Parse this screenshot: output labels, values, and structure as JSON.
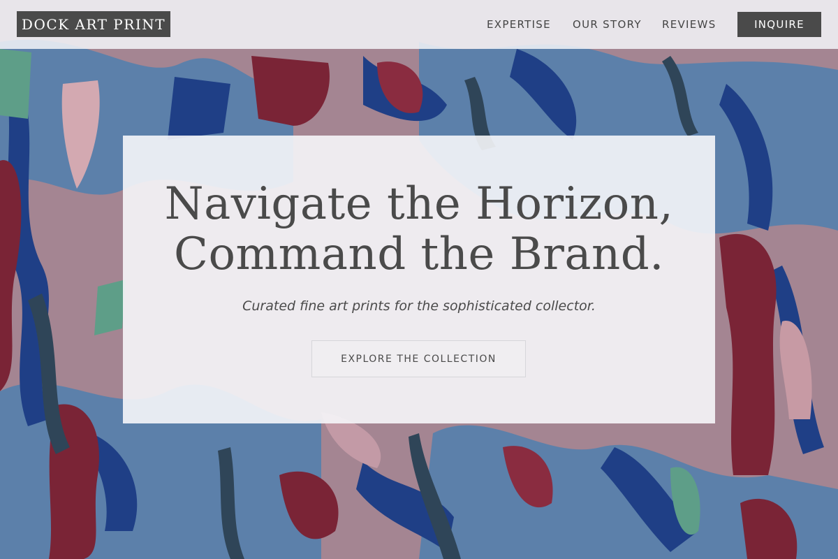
{
  "brand": {
    "logo_text": "DOCK ART PRINT"
  },
  "nav": {
    "items": [
      {
        "label": "EXPERTISE"
      },
      {
        "label": "OUR STORY"
      },
      {
        "label": "REVIEWS"
      }
    ],
    "cta_label": "INQUIRE"
  },
  "hero": {
    "headline_line1": "Navigate the Horizon,",
    "headline_line2": "Command the Brand.",
    "tagline": "Curated fine art prints for the sophisticated collector.",
    "button_label": "EXPLORE THE COLLECTION"
  },
  "colors": {
    "dark_gray": "#4a4a4a",
    "painting_navy": "#1f3f86",
    "painting_crimson": "#7a2436",
    "painting_rose": "#a88592",
    "painting_slate_blue": "#5a7ea8",
    "painting_teal": "#5e9e88",
    "painting_charcoal": "#2f4558"
  }
}
